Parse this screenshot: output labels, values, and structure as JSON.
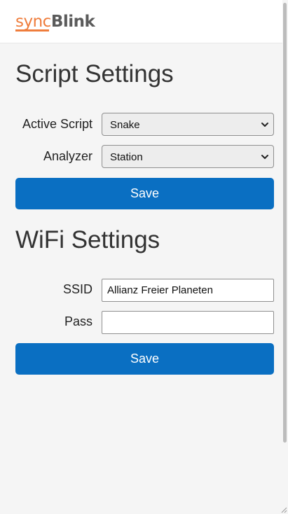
{
  "logo": {
    "part1": "sync",
    "part2": "Blink"
  },
  "script_settings": {
    "title": "Script Settings",
    "active_script_label": "Active Script",
    "active_script_value": "Snake",
    "analyzer_label": "Analyzer",
    "analyzer_value": "Station",
    "save_label": "Save"
  },
  "wifi_settings": {
    "title": "WiFi Settings",
    "ssid_label": "SSID",
    "ssid_value": "Allianz Freier Planeten",
    "pass_label": "Pass",
    "pass_value": "",
    "save_label": "Save"
  },
  "colors": {
    "accent": "#0a6fc2",
    "logo_orange": "#ef7d3c",
    "logo_gray": "#5b5b5b"
  }
}
